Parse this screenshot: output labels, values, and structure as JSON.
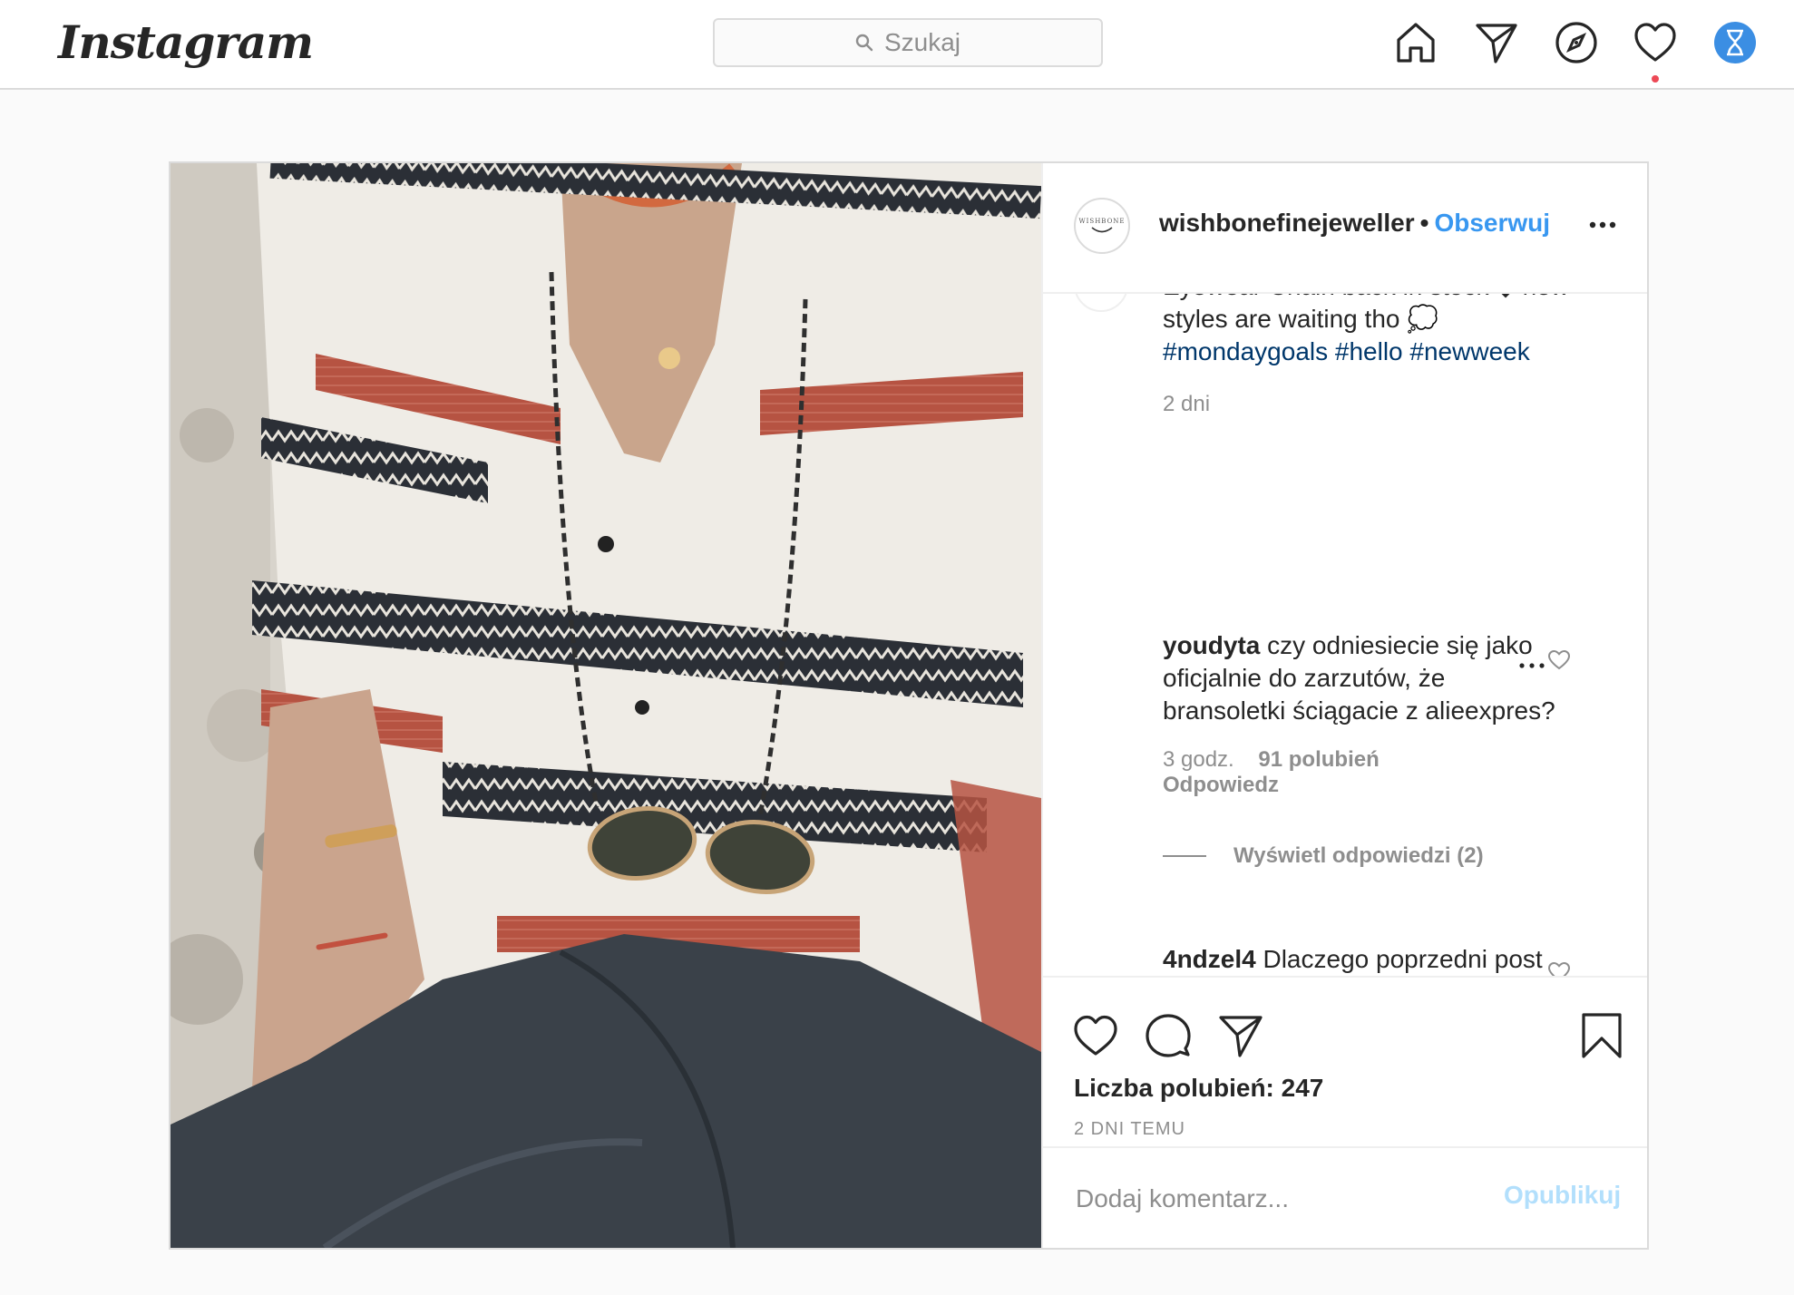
{
  "nav": {
    "logo": "Instagram",
    "search_placeholder": "Szukaj",
    "icons": [
      "home-icon",
      "direct-icon",
      "explore-icon",
      "activity-heart-icon",
      "profile-avatar"
    ]
  },
  "post": {
    "account": "wishbonefinejeweller",
    "separator": "•",
    "follow_label": "Obserwuj",
    "avatar_text": "WISHBONE",
    "caption_partial_line": "Eyewear Chain back in stock ◆  new",
    "caption_line2": "styles are waiting tho 💭",
    "caption_tags": "#mondaygoals #hello #newweek",
    "caption_time": "2 dni",
    "comments": [
      {
        "user": "youdyta",
        "text": "czy odniesiecie się jako oficjalnie do zarzutów, że bransoletki ściągacie z alieexpres?",
        "time": "3 godz.",
        "likes": "91 polubień",
        "reply_label": "Odpowiedz"
      },
      {
        "user": "4ndzel4",
        "text": "Dlaczego poprzedni post został usunięty? Może zamiast kasować niepochlebne komentarze warto wyjaśnić sprawę..."
      }
    ],
    "view_replies": "Wyświetl odpowiedzi (2)",
    "likes_count_label": "Liczba polubień: 247",
    "posted_ago": "2 DNI TEMU",
    "add_comment_placeholder": "Dodaj komentarz...",
    "publish_label": "Opublikuj"
  },
  "colors": {
    "link_blue": "#3897f0",
    "hashtag_blue": "#00376b",
    "muted_gray": "#8e8e8e",
    "notification_red": "#ed4956",
    "publish_disabled": "#b2dffc"
  }
}
